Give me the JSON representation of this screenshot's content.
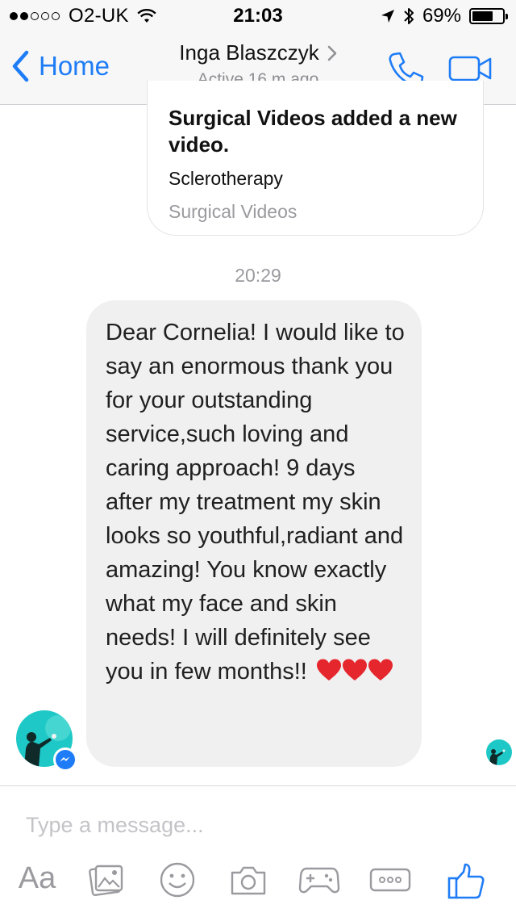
{
  "status_bar": {
    "carrier": "O2-UK",
    "time": "21:03",
    "battery_percent": "69%",
    "battery_level": 0.69,
    "signal_bars_filled": 2,
    "signal_bars_total": 5
  },
  "nav": {
    "back_label": "Home",
    "contact_name": "Inga Blaszczyk",
    "contact_status": "Active 16 m ago",
    "accent_color": "#1e7cf6"
  },
  "shared_post": {
    "headline": "Surgical Videos added a new video.",
    "title": "Sclerotherapy",
    "source": "Surgical Videos"
  },
  "thread": {
    "timestamp": "20:29",
    "message": "Dear Cornelia! I would like to say an enormous thank you for your outstanding service,such loving and caring approach! 9 days after my treatment my skin looks so youthful,radiant and amazing! You know exactly what my face and skin needs! I will definitely see you in few months!!",
    "message_emoji": "❤️❤️❤️"
  },
  "composer": {
    "placeholder": "Type a message...",
    "text_button_label": "Aa",
    "icons": [
      "aa-icon",
      "gallery-icon",
      "emoji-icon",
      "camera-icon",
      "game-controller-icon",
      "more-icon",
      "like-thumb-icon"
    ]
  }
}
